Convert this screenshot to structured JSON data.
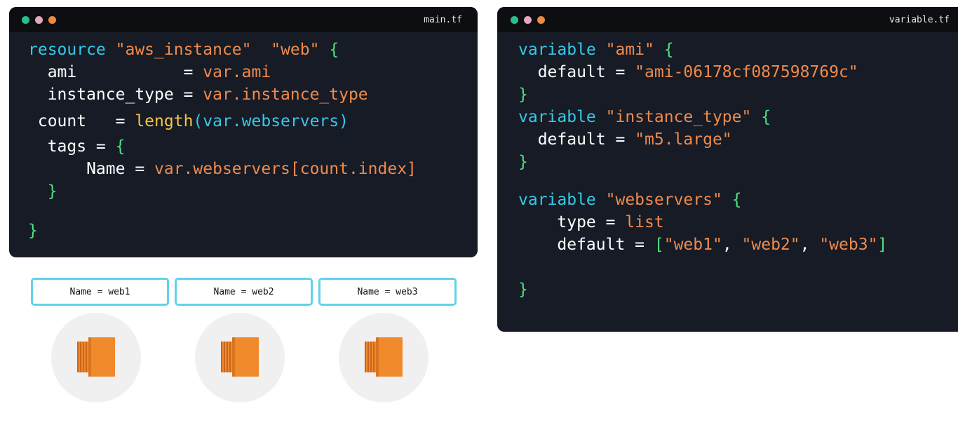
{
  "colors": {
    "window_bg": "#161b25",
    "titlebar_bg": "#0c0e12",
    "dot_green": "#27c089",
    "dot_pink": "#e7a6c0",
    "dot_orange": "#f08a3e",
    "keyword": "#35c9e8",
    "string": "#f08a4c",
    "brace": "#4fe07e",
    "function": "#f5c542",
    "plain": "#ffffff",
    "box_border": "#5fd3ea",
    "ec2_orange": "#f1892d"
  },
  "main_window": {
    "filename": "main.tf",
    "lines": [
      [
        {
          "t": "resource",
          "c": "keyword"
        },
        {
          "t": " ",
          "c": "plain"
        },
        {
          "t": "\"aws_instance\"",
          "c": "string"
        },
        {
          "t": "  ",
          "c": "plain"
        },
        {
          "t": "\"web\"",
          "c": "string"
        },
        {
          "t": " ",
          "c": "plain"
        },
        {
          "t": "{",
          "c": "brace"
        }
      ],
      [
        {
          "t": "  ami           = ",
          "c": "plain"
        },
        {
          "t": "var.ami",
          "c": "string"
        }
      ],
      [
        {
          "t": "  instance_type = ",
          "c": "plain"
        },
        {
          "t": "var.instance_type",
          "c": "string"
        }
      ],
      [
        {
          "t": " count   = ",
          "c": "plain"
        },
        {
          "t": "length",
          "c": "function"
        },
        {
          "t": "(var.webservers)",
          "c": "keyword"
        }
      ],
      [
        {
          "t": "  tags = ",
          "c": "plain"
        },
        {
          "t": "{",
          "c": "brace"
        }
      ],
      [
        {
          "t": "      Name = ",
          "c": "plain"
        },
        {
          "t": "var.webservers[count.index]",
          "c": "string"
        }
      ],
      [
        {
          "t": "  ",
          "c": "plain"
        },
        {
          "t": "}",
          "c": "brace"
        }
      ],
      [
        {
          "t": "}",
          "c": "brace"
        }
      ]
    ]
  },
  "variable_window": {
    "filename": "variable.tf",
    "lines": [
      [
        {
          "t": "variable",
          "c": "keyword"
        },
        {
          "t": " ",
          "c": "plain"
        },
        {
          "t": "\"ami\"",
          "c": "string"
        },
        {
          "t": " ",
          "c": "plain"
        },
        {
          "t": "{",
          "c": "brace"
        }
      ],
      [
        {
          "t": "  default = ",
          "c": "plain"
        },
        {
          "t": "\"ami-06178cf087598769c\"",
          "c": "string"
        }
      ],
      [
        {
          "t": "}",
          "c": "brace"
        }
      ],
      [
        {
          "t": "variable",
          "c": "keyword"
        },
        {
          "t": " ",
          "c": "plain"
        },
        {
          "t": "\"instance_type\"",
          "c": "string"
        },
        {
          "t": " ",
          "c": "plain"
        },
        {
          "t": "{",
          "c": "brace"
        }
      ],
      [
        {
          "t": "  default = ",
          "c": "plain"
        },
        {
          "t": "\"m5.large\"",
          "c": "string"
        }
      ],
      [
        {
          "t": "}",
          "c": "brace"
        }
      ],
      [
        {
          "t": "variable",
          "c": "keyword"
        },
        {
          "t": " ",
          "c": "plain"
        },
        {
          "t": "\"webservers\"",
          "c": "string"
        },
        {
          "t": " ",
          "c": "plain"
        },
        {
          "t": "{",
          "c": "brace"
        }
      ],
      [
        {
          "t": "    type = ",
          "c": "plain"
        },
        {
          "t": "list",
          "c": "string"
        }
      ],
      [
        {
          "t": "    default = ",
          "c": "plain"
        },
        {
          "t": "[",
          "c": "brace"
        },
        {
          "t": "\"web1\"",
          "c": "string"
        },
        {
          "t": ", ",
          "c": "plain"
        },
        {
          "t": "\"web2\"",
          "c": "string"
        },
        {
          "t": ", ",
          "c": "plain"
        },
        {
          "t": "\"web3\"",
          "c": "string"
        },
        {
          "t": "]",
          "c": "brace"
        }
      ],
      [],
      [
        {
          "t": "}",
          "c": "brace"
        }
      ]
    ]
  },
  "instances": [
    {
      "label": "Name = web1",
      "icon": "ec2-instance-icon"
    },
    {
      "label": "Name = web2",
      "icon": "ec2-instance-icon"
    },
    {
      "label": "Name = web3",
      "icon": "ec2-instance-icon"
    }
  ]
}
